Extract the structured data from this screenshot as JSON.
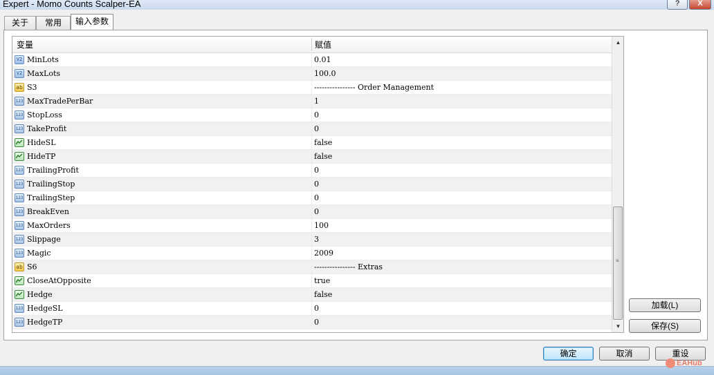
{
  "window": {
    "title": "Expert - Momo Counts Scalper-EA",
    "help_label": "?",
    "close_label": "X"
  },
  "tabs": [
    {
      "label": "关于"
    },
    {
      "label": "常用"
    },
    {
      "label": "输入参数"
    }
  ],
  "active_tab": "输入参数",
  "grid": {
    "headers": {
      "variable": "变量",
      "value": "赋值"
    },
    "rows": [
      {
        "type": "double",
        "icon": "V2",
        "name": "MinLots",
        "value": "0.01"
      },
      {
        "type": "double",
        "icon": "V2",
        "name": "MaxLots",
        "value": "100.0"
      },
      {
        "type": "string",
        "icon": "ab",
        "name": "S3",
        "value": "---------------- Order Management"
      },
      {
        "type": "int",
        "icon": "123",
        "name": "MaxTradePerBar",
        "value": "1"
      },
      {
        "type": "int",
        "icon": "123",
        "name": "StopLoss",
        "value": "0"
      },
      {
        "type": "int",
        "icon": "123",
        "name": "TakeProfit",
        "value": "0"
      },
      {
        "type": "bool",
        "icon": "",
        "name": "HideSL",
        "value": "false"
      },
      {
        "type": "bool",
        "icon": "",
        "name": "HideTP",
        "value": "false"
      },
      {
        "type": "int",
        "icon": "123",
        "name": "TrailingProfit",
        "value": "0"
      },
      {
        "type": "int",
        "icon": "123",
        "name": "TrailingStop",
        "value": "0"
      },
      {
        "type": "int",
        "icon": "123",
        "name": "TrailingStep",
        "value": "0"
      },
      {
        "type": "int",
        "icon": "123",
        "name": "BreakEven",
        "value": "0"
      },
      {
        "type": "int",
        "icon": "123",
        "name": "MaxOrders",
        "value": "100"
      },
      {
        "type": "int",
        "icon": "123",
        "name": "Slippage",
        "value": "3"
      },
      {
        "type": "int",
        "icon": "123",
        "name": "Magic",
        "value": "2009"
      },
      {
        "type": "string",
        "icon": "ab",
        "name": "S6",
        "value": "---------------- Extras"
      },
      {
        "type": "bool",
        "icon": "",
        "name": "CloseAtOpposite",
        "value": "true"
      },
      {
        "type": "bool",
        "icon": "",
        "name": "Hedge",
        "value": "false"
      },
      {
        "type": "int",
        "icon": "123",
        "name": "HedgeSL",
        "value": "0"
      },
      {
        "type": "int",
        "icon": "123",
        "name": "HedgeTP",
        "value": "0"
      }
    ]
  },
  "buttons": {
    "load": "加载(L)",
    "save": "保存(S)",
    "ok": "确定",
    "cancel": "取消",
    "reset": "重设"
  },
  "watermark": "EAHub"
}
